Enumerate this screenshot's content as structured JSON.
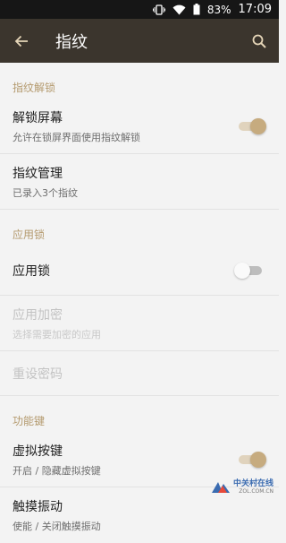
{
  "status_bar": {
    "battery_percent_label": "83%",
    "time": "17:09"
  },
  "app_bar": {
    "title": "指纹",
    "back_icon": "arrow-back-icon",
    "search_icon": "search-icon"
  },
  "sections": {
    "fingerprint_unlock": {
      "header": "指纹解锁",
      "unlock_screen": {
        "title": "解锁屏幕",
        "subtitle": "允许在锁屏界面使用指纹解锁",
        "enabled": true
      },
      "fingerprint_manage": {
        "title": "指纹管理",
        "subtitle": "已录入3个指纹"
      }
    },
    "app_lock": {
      "header": "应用锁",
      "app_lock_item": {
        "title": "应用锁",
        "enabled": false
      },
      "app_encrypt": {
        "title": "应用加密",
        "subtitle": "选择需要加密的应用"
      },
      "reset_password": {
        "title": "重设密码"
      }
    },
    "function_keys": {
      "header": "功能键",
      "virtual_keys": {
        "title": "虚拟按键",
        "subtitle": "开启 / 隐藏虚拟按键",
        "enabled": true
      },
      "haptic": {
        "title": "触摸振动",
        "subtitle": "使能 / 关闭触摸振动"
      }
    }
  },
  "watermark": {
    "cn": "中关村在线",
    "en": "ZOL.COM.CN"
  },
  "colors": {
    "accent": "#c6ab7f",
    "app_bar": "#3b352d",
    "section_header": "#b49a6e"
  }
}
